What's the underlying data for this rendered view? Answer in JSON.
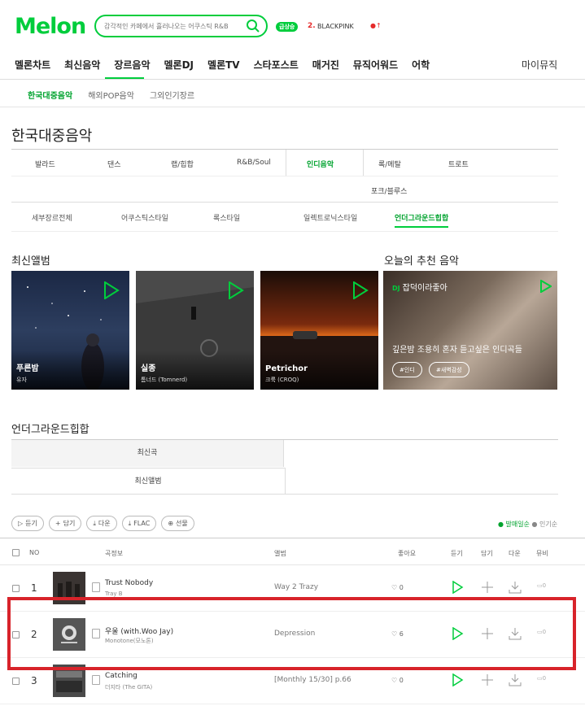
{
  "header": {
    "logo": "Melon",
    "search_placeholder": "감각적인 카페에서 흘러나오는 어쿠스틱 R&B",
    "rank_badge": "급상승",
    "rank_num": "2.",
    "rank_name": "BLACKPINK",
    "rank_flag": "●↑"
  },
  "gnb": {
    "items": [
      "멜론차트",
      "최신음악",
      "장르음악",
      "멜론DJ",
      "멜론TV",
      "스타포스트",
      "매거진",
      "뮤직어워드",
      "어학"
    ],
    "my_music": "마이뮤직"
  },
  "subnav": [
    "한국대중음악",
    "해외POP음악",
    "그외인기장르"
  ],
  "page_title": "한국대중음악",
  "genres_row1": [
    "발라드",
    "댄스",
    "랩/힙합",
    "R&B/Soul",
    "인디음악",
    "록/메탈",
    "트로트"
  ],
  "genres_row2": [
    "포크/블루스"
  ],
  "genre_sub": [
    "세부장르전체",
    "어쿠스틱스타일",
    "록스타일",
    "일렉트로닉스타일",
    "언더그라운드힙합"
  ],
  "latest_title": "최신앨범",
  "albums": [
    {
      "title": "푸른밤",
      "artist": "유자"
    },
    {
      "title": "실종",
      "artist": "톰너드 (Tomnerd)"
    },
    {
      "title": "Petrichor",
      "artist": "크룩 (CROQ)"
    }
  ],
  "rec": {
    "title": "오늘의 추천 음악",
    "dj_badge": "DJ",
    "dj_name": "잡덕이라좋아",
    "desc": "깊은밤 조용히 혼자 듣고싶은 인디곡들",
    "tags": [
      "#인디",
      "#새벽감성"
    ]
  },
  "hiphop": {
    "title": "언더그라운드힙합",
    "tab_songs": "최신곡",
    "tab_albums": "최신앨범"
  },
  "buttons": [
    "듣기",
    "담기",
    "다운",
    "FLAC",
    "선물"
  ],
  "sort": {
    "sales": "● 발매일순",
    "popular": "● 인기순"
  },
  "table": {
    "headers": {
      "no": "NO",
      "song": "곡정보",
      "album": "앨범",
      "like": "좋아요",
      "play": "듣기",
      "add": "담기",
      "down": "다운",
      "mv": "뮤비"
    }
  },
  "rows": [
    {
      "num": "1",
      "song": "Trust Nobody",
      "artist": "Tray B",
      "album": "Way 2 Trazy",
      "likes": "0",
      "mv": "0"
    },
    {
      "num": "2",
      "song": "우울 (with.Woo Jay)",
      "artist": "Monotone(모노톤)",
      "album": "Depression",
      "likes": "6",
      "mv": "0"
    },
    {
      "num": "3",
      "song": "Catching",
      "artist": "더지타 (The GITA)",
      "album": "[Monthly 15/30] p.66",
      "likes": "0",
      "mv": "0"
    }
  ],
  "colors": {
    "accent": "#00cd3c",
    "highlight": "#d8232a"
  }
}
